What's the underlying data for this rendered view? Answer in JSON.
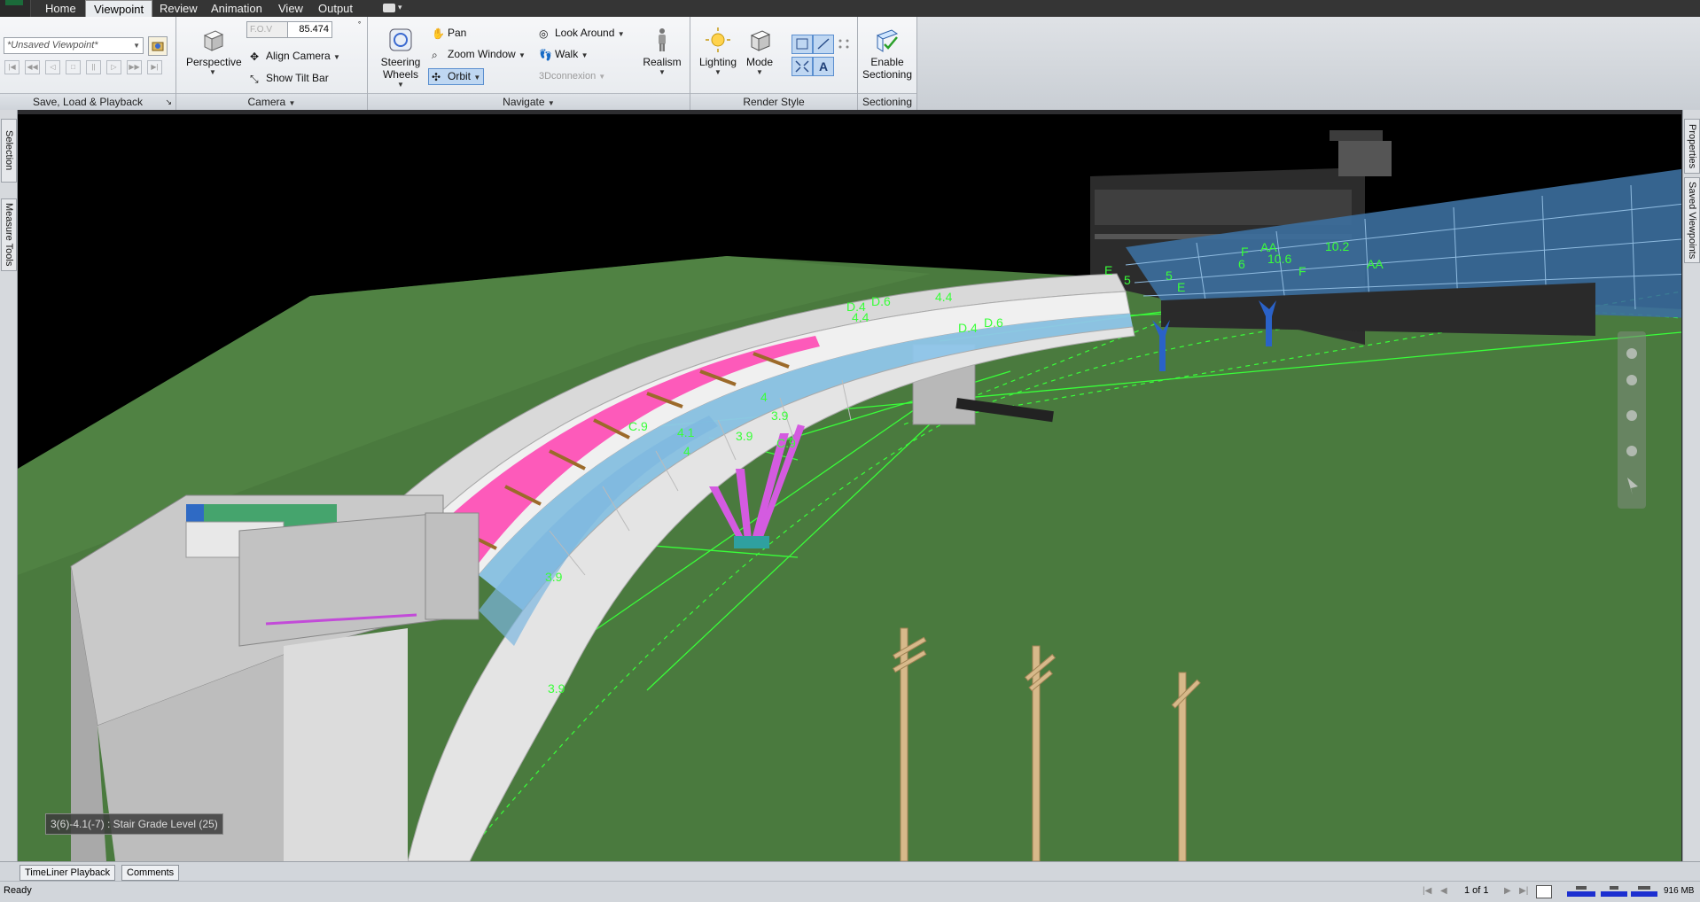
{
  "menu": {
    "tabs": [
      "Home",
      "Viewpoint",
      "Review",
      "Animation",
      "View",
      "Output"
    ],
    "active_tab": "Viewpoint"
  },
  "ribbon": {
    "save_load_playback": {
      "title": "Save, Load & Playback",
      "viewpoint_value": "*Unsaved Viewpoint*"
    },
    "camera": {
      "title": "Camera",
      "perspective_label": "Perspective",
      "fov_label": "F.O.V",
      "fov_value": "85.474",
      "align_camera_label": "Align Camera",
      "show_tilt_bar_label": "Show Tilt Bar"
    },
    "navigate": {
      "title": "Navigate",
      "steering_wheels_label_1": "Steering",
      "steering_wheels_label_2": "Wheels",
      "pan_label": "Pan",
      "zoom_window_label": "Zoom Window",
      "orbit_label": "Orbit",
      "look_around_label": "Look Around",
      "walk_label": "Walk",
      "connexion_label": "3Dconnexion",
      "realism_label": "Realism"
    },
    "render_style": {
      "title": "Render Style",
      "lighting_label": "Lighting",
      "mode_label": "Mode",
      "text_toggle_label": "A"
    },
    "sectioning": {
      "title": "Sectioning",
      "enable_label_1": "Enable",
      "enable_label_2": "Sectioning"
    }
  },
  "side_tabs": {
    "left": [
      "Selection Tree",
      "Measure Tools"
    ],
    "right": [
      "Properties",
      "Saved Viewpoints"
    ]
  },
  "viewport": {
    "tooltip": "3(6)-4.1(-7) : Stair Grade Level (25)",
    "grid_labels": [
      "10.2",
      "AA",
      "AA",
      "10.6",
      "F",
      "6",
      "F",
      "E",
      "5",
      "5",
      "E",
      "4.4",
      "D.6",
      "D.4",
      "4.4",
      "D.4",
      "D.6",
      "4",
      "3.9",
      "C.9",
      "4.1",
      "3.9",
      "C.9",
      "4",
      "3.9",
      "3.9"
    ]
  },
  "bottom_tabs": [
    "TimeLiner Playback",
    "Comments"
  ],
  "status": {
    "text": "Ready",
    "page": "1 of 1",
    "memory": "916 MB"
  },
  "colors": {
    "grid_lines": "#39ff39",
    "ground": "#4a7a3e",
    "sky": "#000000",
    "ribbon_bg": "#eef0f3"
  }
}
